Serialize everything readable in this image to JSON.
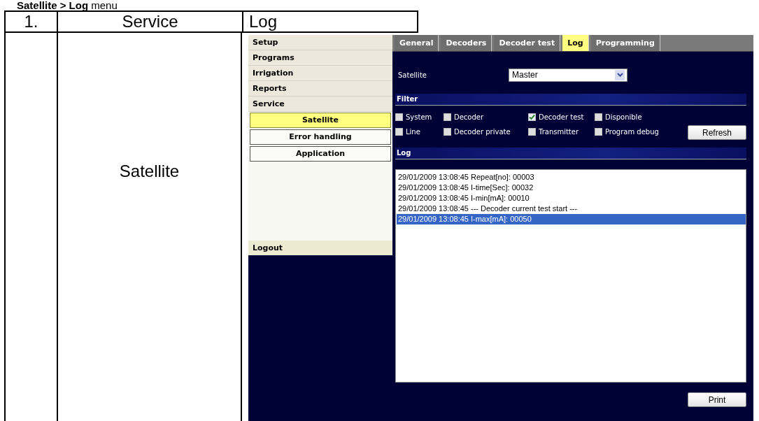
{
  "heading": {
    "parts": "**Satellite > Log** menu"
  },
  "doc_table": {
    "header": [
      "1.",
      "Service",
      "Log"
    ],
    "row": {
      "column_2": "Satellite"
    }
  },
  "screen": {
    "sidebar": {
      "items": [
        {
          "label": "Setup"
        },
        {
          "label": "Programs"
        },
        {
          "label": "Irrigation"
        },
        {
          "label": "Reports"
        },
        {
          "label": "Service"
        }
      ],
      "subitems": [
        {
          "label": "Satellite",
          "selected": true
        },
        {
          "label": "Error handling",
          "selected": false
        },
        {
          "label": "Application",
          "selected": false
        }
      ],
      "logout": "Logout"
    },
    "tabs": [
      {
        "label": "General",
        "selected": false
      },
      {
        "label": "Decoders",
        "selected": false
      },
      {
        "label": "Decoder test",
        "selected": false
      },
      {
        "label": "Log",
        "selected": true
      },
      {
        "label": "Programming",
        "selected": false
      }
    ],
    "satellite_field": {
      "label": "Satellite",
      "value": "Master"
    },
    "filter": {
      "title": "Filter",
      "options": [
        {
          "label": "System",
          "checked": false
        },
        {
          "label": "Decoder",
          "checked": false
        },
        {
          "label": "Decoder test",
          "checked": true
        },
        {
          "label": "Disponible",
          "checked": false
        },
        {
          "label": "Line",
          "checked": false
        },
        {
          "label": "Decoder private",
          "checked": false
        },
        {
          "label": "Transmitter",
          "checked": false
        },
        {
          "label": "Program debug",
          "checked": false
        }
      ],
      "refresh": "Refresh"
    },
    "log": {
      "title": "Log",
      "lines": [
        {
          "text": "29/01/2009 13:08:45 Repeat[no]: 00003",
          "selected": false
        },
        {
          "text": "29/01/2009 13:08:45 I-time[Sec]: 00032",
          "selected": false
        },
        {
          "text": "29/01/2009 13:08:45 I-min[mA]: 00010",
          "selected": false
        },
        {
          "text": "29/01/2009 13:08:45 --- Decoder current test start ---",
          "selected": false
        },
        {
          "text": "29/01/2009 13:08:45 I-max[mA]: 00050",
          "selected": true
        }
      ],
      "print": "Print"
    }
  }
}
